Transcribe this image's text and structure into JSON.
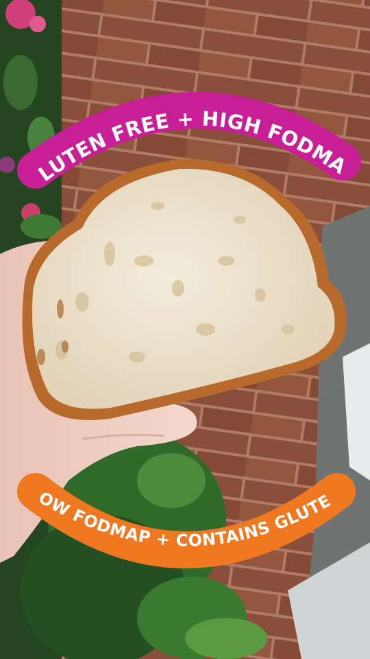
{
  "banners": {
    "top": {
      "text": "GLUTEN FREE + HIGH FODMAP",
      "color": "#c81e96"
    },
    "bottom": {
      "text": "LOW FODMAP + CONTAINS GLUTEN",
      "color": "#f07820"
    }
  },
  "colors": {
    "brick": "#8a4f3a",
    "mortar": "#b07c66",
    "crust": "#b86a2c",
    "crumb": "#ece2cf",
    "skin": "#f0d0c4",
    "foliage": "#2f6a2a"
  }
}
